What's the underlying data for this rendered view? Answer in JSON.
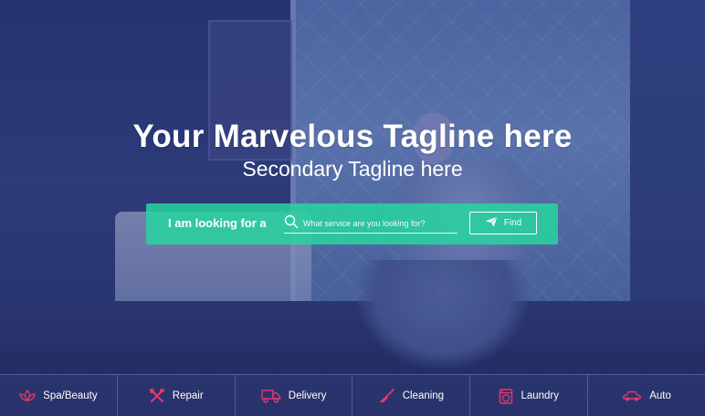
{
  "hero": {
    "headline": "Your Marvelous Tagline here",
    "subheadline": "Secondary Tagline here"
  },
  "search": {
    "label": "I am looking for a",
    "placeholder": "What service are you looking for?",
    "button_label": "Find",
    "bar_color": "#28d4a0"
  },
  "categories": [
    {
      "label": "Spa/Beauty",
      "icon": "spa-icon"
    },
    {
      "label": "Repair",
      "icon": "tools-icon"
    },
    {
      "label": "Delivery",
      "icon": "truck-icon"
    },
    {
      "label": "Cleaning",
      "icon": "broom-icon"
    },
    {
      "label": "Laundry",
      "icon": "washing-machine-icon"
    },
    {
      "label": "Auto",
      "icon": "car-icon"
    }
  ],
  "colors": {
    "accent_icon": "#e8386c",
    "overlay": "#2a2e78"
  }
}
